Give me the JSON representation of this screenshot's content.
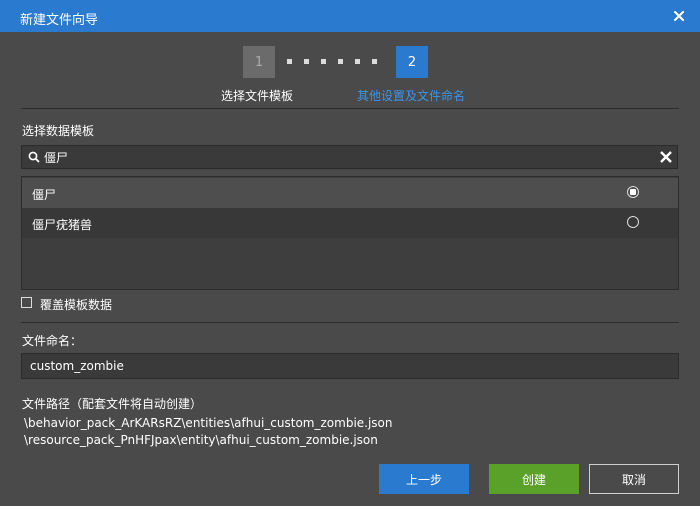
{
  "window": {
    "title": "新建文件向导"
  },
  "stepper": {
    "step1_number": "1",
    "step2_number": "2",
    "step1_label": "选择文件模板",
    "step2_label": "其他设置及文件命名"
  },
  "template_section": {
    "label": "选择数据模板",
    "search_value": "僵尸",
    "items": [
      {
        "label": "僵尸",
        "selected": true
      },
      {
        "label": "僵尸疣猪兽",
        "selected": false
      }
    ]
  },
  "override_checkbox": {
    "label": "覆盖模板数据",
    "checked": false
  },
  "filename": {
    "label": "文件命名：",
    "value": "custom_zombie"
  },
  "filepath": {
    "label": "文件路径（配套文件将自动创建）",
    "paths": [
      "\\behavior_pack_ArKARsRZ\\entities\\afhui_custom_zombie.json",
      "\\resource_pack_PnHFJpax\\entity\\afhui_custom_zombie.json"
    ]
  },
  "buttons": {
    "prev": "上一步",
    "create": "创建",
    "cancel": "取消"
  },
  "colors": {
    "accent": "#2a7bd0",
    "create": "#5aa12a",
    "background": "#4a4a4a"
  },
  "icons": {
    "close": "close-icon",
    "search": "search-icon",
    "clear": "clear-icon"
  }
}
